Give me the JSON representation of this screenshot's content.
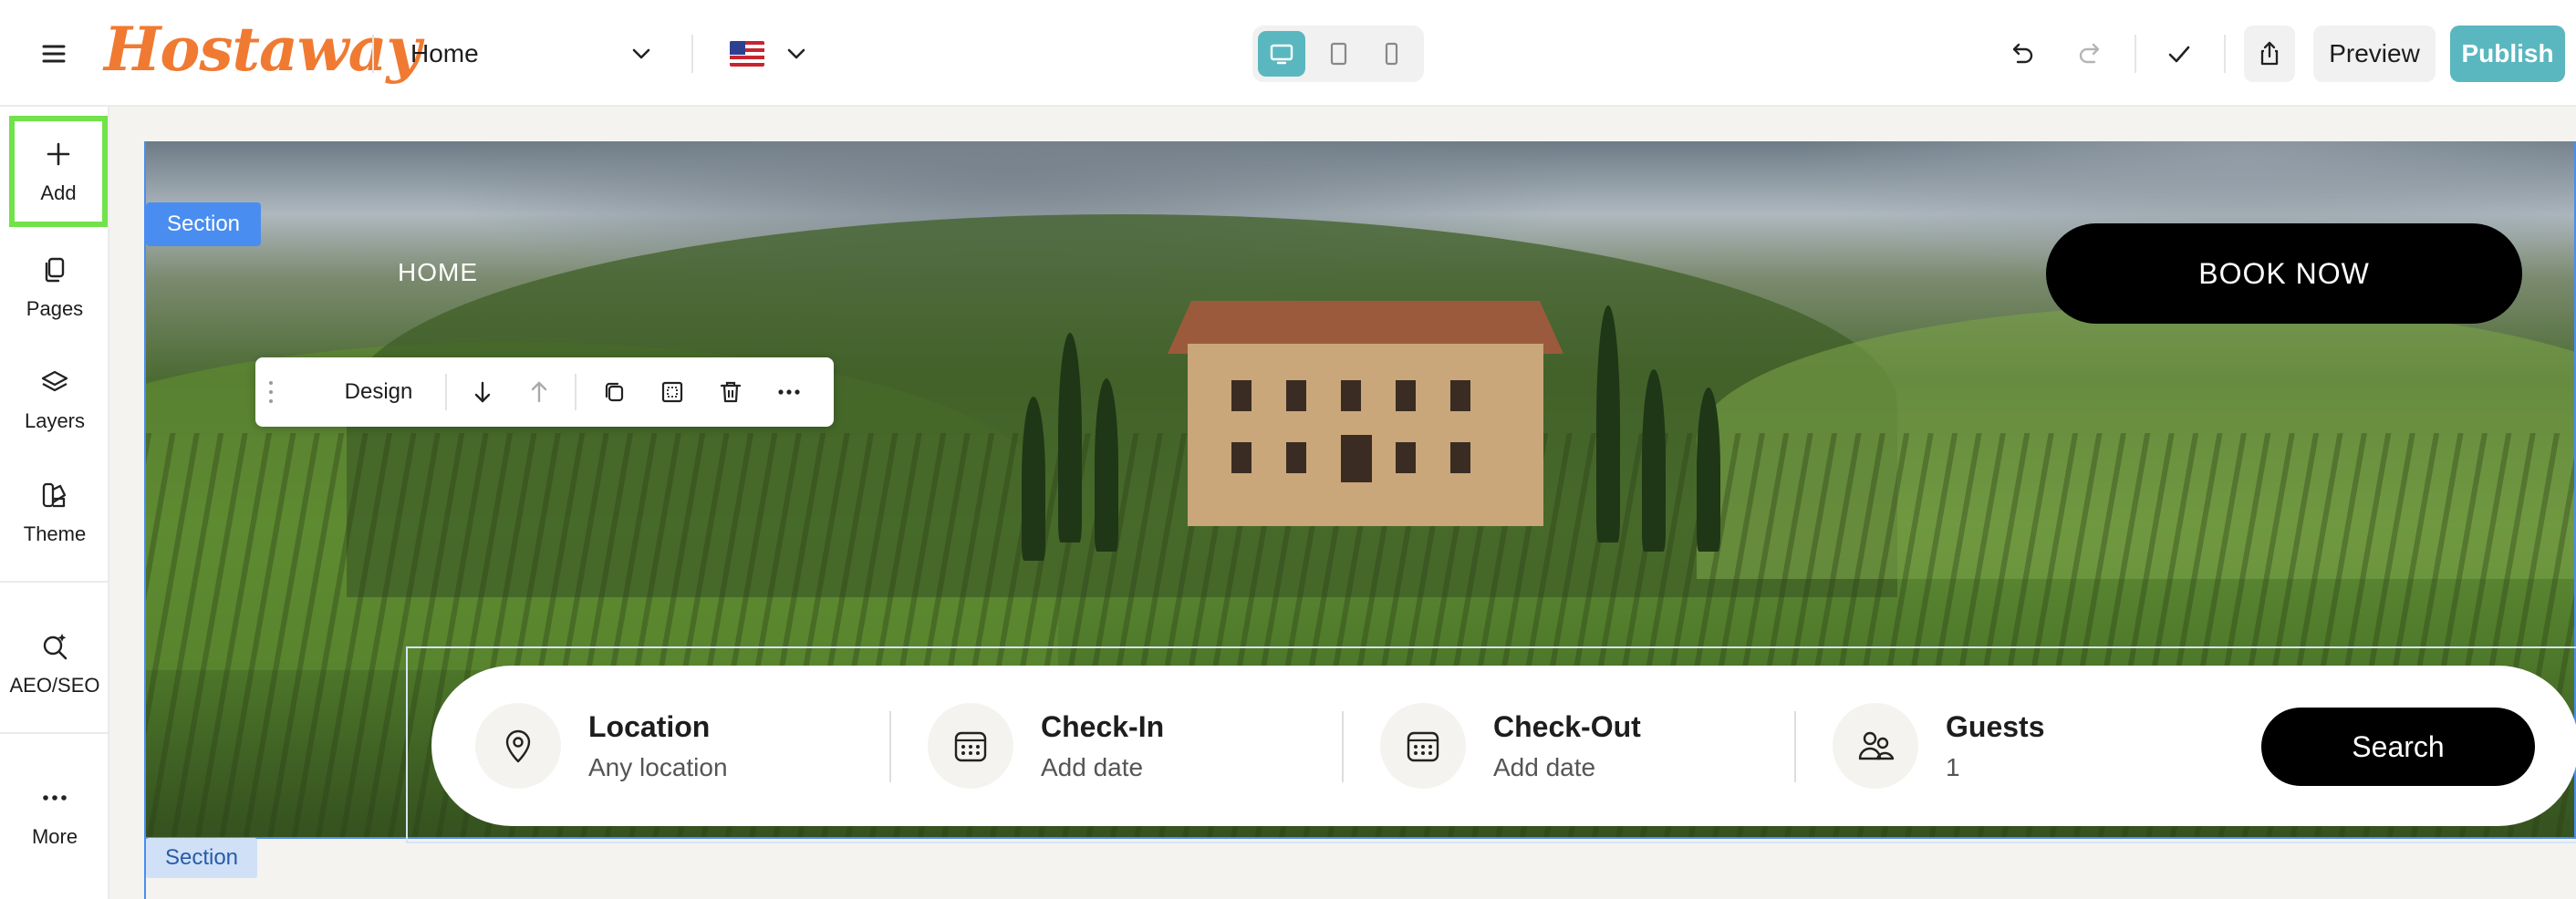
{
  "app": {
    "logo_text": "Hostaway",
    "brand_color": "#f07a32",
    "accent_color": "#5ab7bf"
  },
  "topbar": {
    "page_select_label": "Home",
    "language_flag": "us-flag-icon",
    "devices": [
      "desktop-icon",
      "tablet-icon",
      "mobile-icon"
    ],
    "active_device": "desktop",
    "preview_label": "Preview",
    "publish_label": "Publish"
  },
  "sidebar": {
    "items": [
      {
        "label": "Add",
        "icon": "plus-icon"
      },
      {
        "label": "Pages",
        "icon": "pages-icon"
      },
      {
        "label": "Layers",
        "icon": "layers-icon"
      },
      {
        "label": "Theme",
        "icon": "theme-icon"
      },
      {
        "label": "AEO/SEO",
        "icon": "seo-search-icon"
      },
      {
        "label": "More",
        "icon": "more-dots-icon"
      }
    ]
  },
  "canvas": {
    "section_tag": "Section",
    "section_tag_bottom": "Section",
    "toolbar": {
      "design_label": "Design"
    },
    "hero": {
      "nav_home": "HOME",
      "book_now_label": "BOOK NOW"
    },
    "search": {
      "fields": [
        {
          "title": "Location",
          "value": "Any location",
          "icon": "map-pin-icon"
        },
        {
          "title": "Check-In",
          "value": "Add date",
          "icon": "calendar-icon"
        },
        {
          "title": "Check-Out",
          "value": "Add date",
          "icon": "calendar-icon"
        },
        {
          "title": "Guests",
          "value": "1",
          "icon": "guests-icon"
        }
      ],
      "button_label": "Search"
    }
  }
}
